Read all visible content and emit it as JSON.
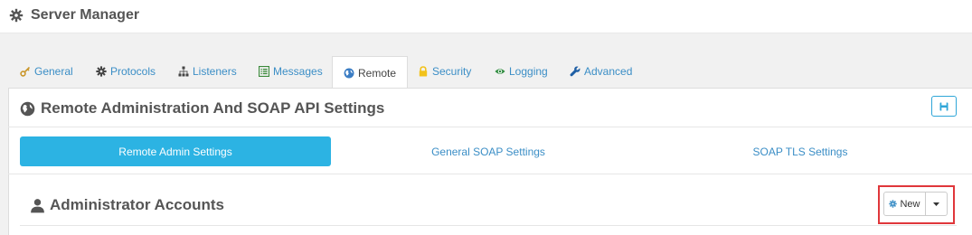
{
  "app": {
    "title": "Server Manager"
  },
  "tabs": [
    {
      "label": "General",
      "icon": "key-icon"
    },
    {
      "label": "Protocols",
      "icon": "gear-icon"
    },
    {
      "label": "Listeners",
      "icon": "sitemap-icon"
    },
    {
      "label": "Messages",
      "icon": "list-icon"
    },
    {
      "label": "Remote",
      "icon": "globe-icon",
      "active": true
    },
    {
      "label": "Security",
      "icon": "lock-icon"
    },
    {
      "label": "Logging",
      "icon": "eye-icon"
    },
    {
      "label": "Advanced",
      "icon": "wrench-icon"
    }
  ],
  "section": {
    "title": "Remote Administration And SOAP API Settings"
  },
  "subtabs": [
    {
      "label": "Remote Admin Settings",
      "active": true
    },
    {
      "label": "General SOAP Settings"
    },
    {
      "label": "SOAP TLS Settings"
    }
  ],
  "accounts": {
    "title": "Administrator Accounts",
    "new_label": "New"
  },
  "colors": {
    "accent": "#2cb3e3",
    "link": "#3b8ec6",
    "highlight": "#e0373b",
    "tab_lock": "#f2c21b",
    "tab_eye": "#2e8b3e",
    "tab_messages": "#3a8a3a"
  }
}
